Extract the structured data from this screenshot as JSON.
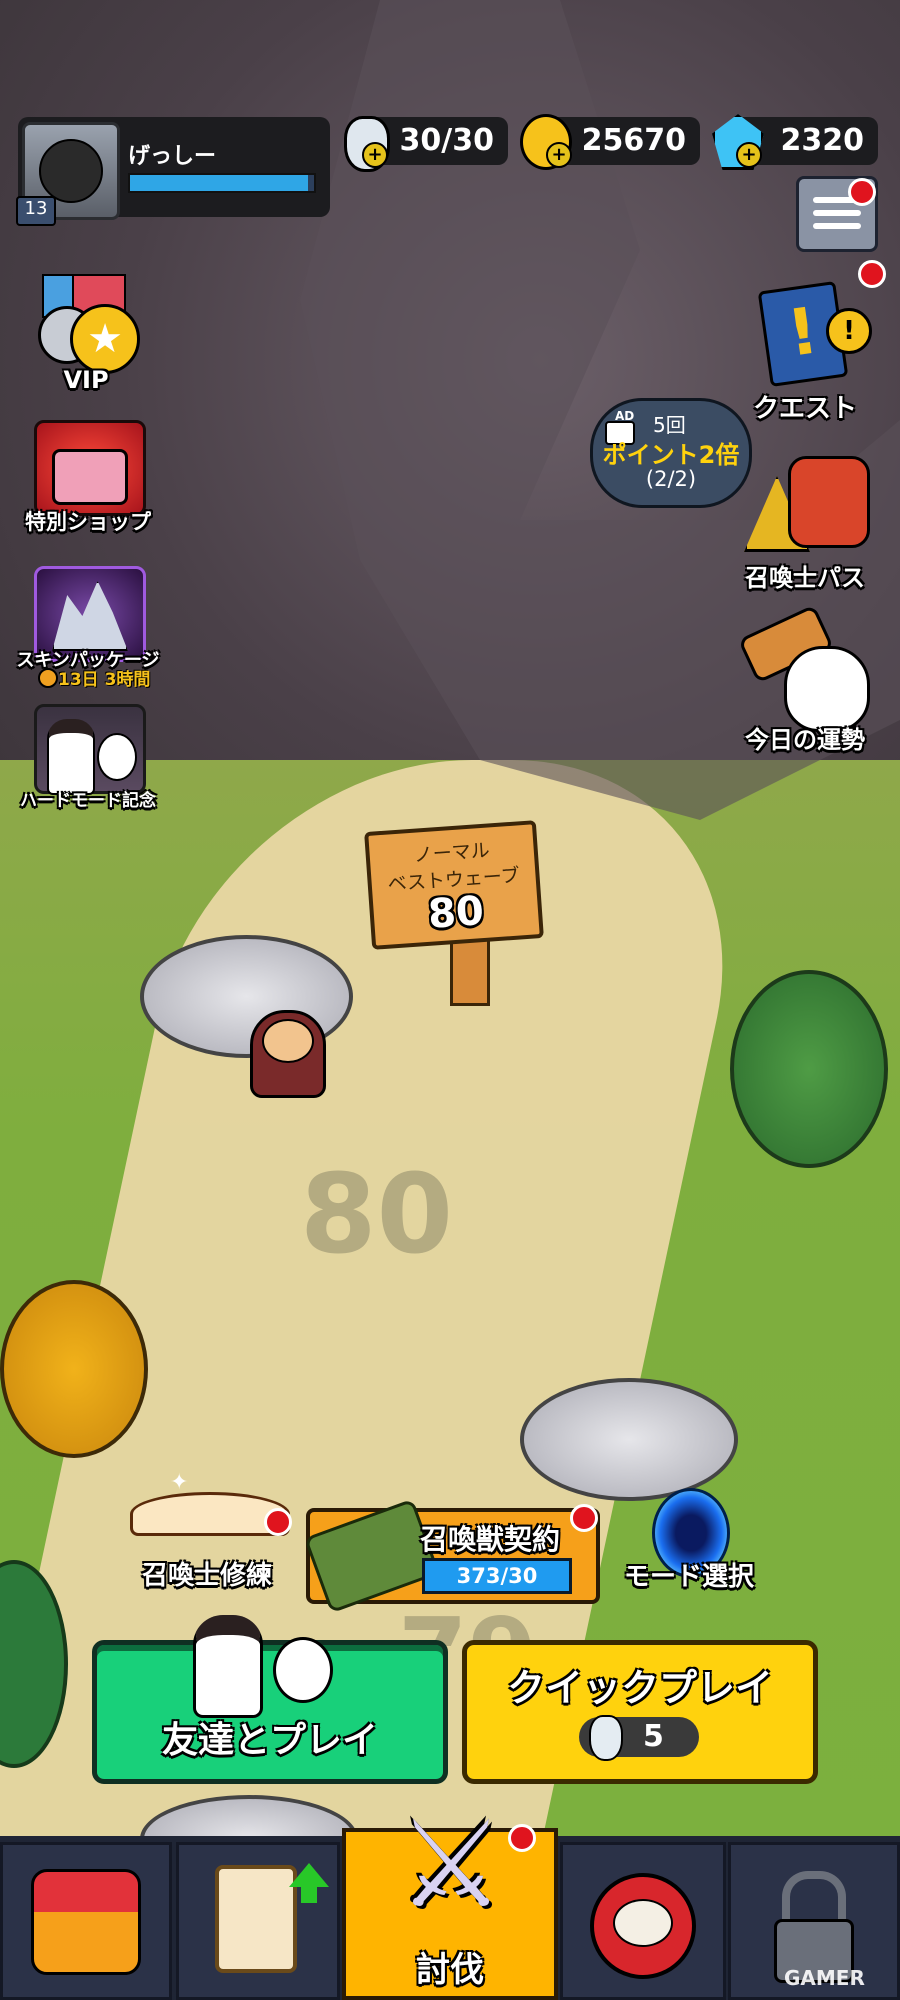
{
  "player": {
    "name": "げっしー",
    "level": "13",
    "exp_fraction": 0.97
  },
  "resources": {
    "stamina": "30/30",
    "coins": "25670",
    "gems": "2320"
  },
  "left_menu": [
    {
      "label": "VIP",
      "icon": "vip-medal-icon"
    },
    {
      "label": "特別ショップ",
      "icon": "treasure-chest-icon"
    },
    {
      "label": "スキンパッケージ",
      "icon": "werewolf-skin-icon",
      "timer": "13日 3時間"
    },
    {
      "label": "ハードモード記念",
      "icon": "shrine-maiden-icon"
    }
  ],
  "right_menu": [
    {
      "label": "クエスト",
      "icon": "quest-book-icon"
    },
    {
      "label": "召喚士パス",
      "icon": "oni-pass-icon"
    },
    {
      "label": "今日の運勢",
      "icon": "lucky-cat-icon"
    }
  ],
  "ad_bubble": {
    "badge": "AD",
    "count": "5回",
    "title": "ポイント2倍",
    "progress": "(2/2)"
  },
  "signpost": {
    "mode": "ノーマル",
    "caption": "ベストウェーブ",
    "value": "80"
  },
  "wave_markers": {
    "current": "80",
    "next": "79"
  },
  "actions": {
    "training": "召喚士修練",
    "contract": {
      "label": "召喚獣契約",
      "progress": "373/30"
    },
    "mode_select": "モード選択"
  },
  "play_buttons": {
    "friends": "友達とプレイ",
    "quick": "クイックプレイ",
    "quick_cost": "5"
  },
  "bottom_nav": [
    {
      "name": "shop",
      "icon": "shop-stall-icon"
    },
    {
      "name": "cards",
      "icon": "rabbit-card-icon"
    },
    {
      "name": "battle",
      "label": "討伐",
      "icon": "crossed-swords-icon"
    },
    {
      "name": "daruma",
      "icon": "daruma-icon"
    },
    {
      "name": "locked",
      "icon": "lock-icon"
    }
  ],
  "watermark": "GAMER",
  "colors": {
    "green_button": "#18d07a",
    "yellow_button": "#ffd20d",
    "active_tab": "#ffb400",
    "badge_red": "#e0141e"
  }
}
